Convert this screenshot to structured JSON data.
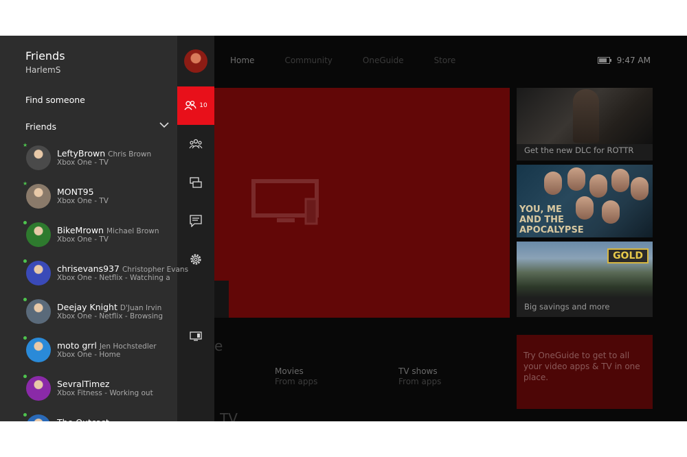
{
  "nav": {
    "tabs": [
      "Home",
      "Community",
      "OneGuide",
      "Store"
    ]
  },
  "status": {
    "time": "9:47 AM"
  },
  "tiles": {
    "dlc": "Get the new DLC for ROTTR",
    "movie_title": "YOU, ME AND THE APOCALYPSE",
    "gold_badge": "GOLD",
    "savings": "Big savings and more",
    "oneguide": "Try OneGuide to get to all your video apps & TV in one place."
  },
  "sub": [
    {
      "title": "Movies",
      "subtitle": "From apps"
    },
    {
      "title": "TV shows",
      "subtitle": "From apps"
    }
  ],
  "fragments": {
    "left_partial": "e",
    "bottom_partial": "TV"
  },
  "rail": {
    "friends_count": "10"
  },
  "panel": {
    "title": "Friends",
    "user": "HarlemS",
    "find_label": "Find someone",
    "friends_header": "Friends"
  },
  "friends": [
    {
      "gamertag": "LeftyBrown",
      "real_name": "Chris Brown",
      "status": "Xbox One - TV",
      "favorite": true,
      "color": "#4a4a4a"
    },
    {
      "gamertag": "MONT95",
      "real_name": "",
      "status": "Xbox One - TV",
      "favorite": true,
      "color": "#8a7a6a"
    },
    {
      "gamertag": "BikeMrown",
      "real_name": "Michael Brown",
      "status": "Xbox One - TV",
      "favorite": false,
      "color": "#2e7a2e"
    },
    {
      "gamertag": "chrisevans937",
      "real_name": "Christopher Evans",
      "status": "Xbox One - Netflix - Watching a S...",
      "favorite": false,
      "color": "#3a4ab8"
    },
    {
      "gamertag": "Deejay Knight",
      "real_name": "D'Juan Irvin",
      "status": "Xbox One - Netflix - Browsing",
      "favorite": false,
      "color": "#5a6a7a"
    },
    {
      "gamertag": "moto grrl",
      "real_name": "Jen Hochstedler",
      "status": "Xbox One - Home",
      "favorite": false,
      "color": "#2a8ad8"
    },
    {
      "gamertag": "SevralTimez",
      "real_name": "",
      "status": "Xbox Fitness - Working out",
      "favorite": false,
      "color": "#8a2aa8"
    },
    {
      "gamertag": "The Outcast",
      "real_name": "",
      "status": "",
      "favorite": false,
      "color": "#2a6ab8"
    }
  ]
}
